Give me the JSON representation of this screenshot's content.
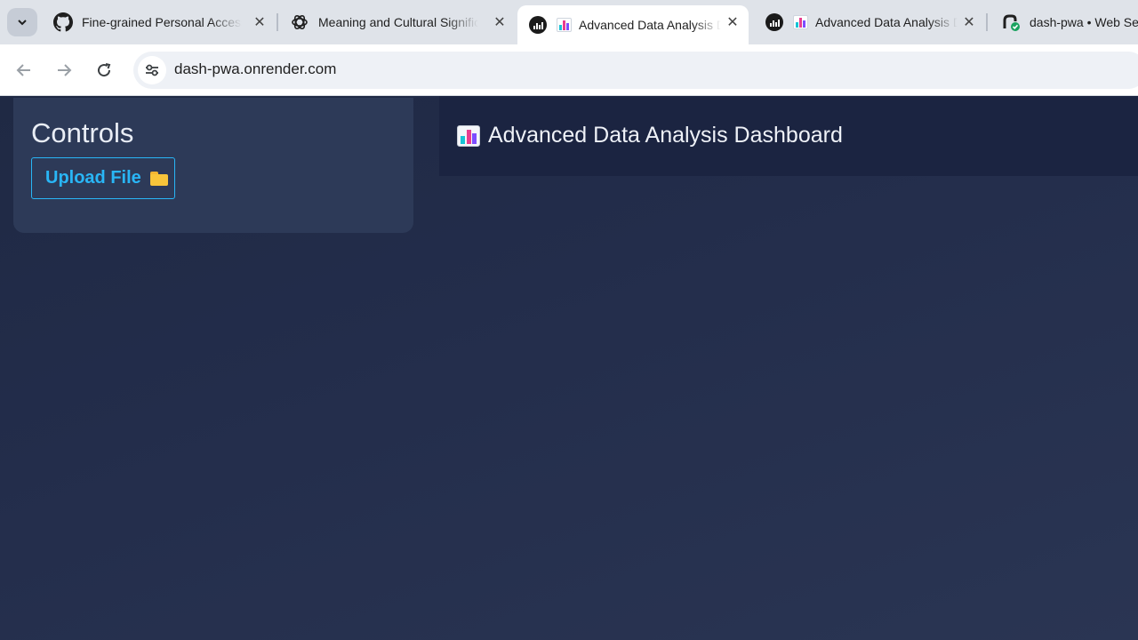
{
  "browser": {
    "tabs": [
      {
        "title": "Fine-grained Personal Access Tokens",
        "icon": "github-icon"
      },
      {
        "title": "Meaning and Cultural Significance",
        "icon": "openai-icon"
      },
      {
        "title": "Advanced Data Analysis Dashboard",
        "icon": "chart-favicon",
        "active": true
      },
      {
        "title": "Advanced Data Analysis Dashboard",
        "icon": "chart-favicon"
      },
      {
        "title": "dash-pwa • Web Service",
        "icon": "render-icon"
      }
    ],
    "url": "dash-pwa.onrender.com"
  },
  "sidebar": {
    "title": "Controls",
    "upload_label": "Upload File"
  },
  "header": {
    "title": "Advanced Data Analysis Dashboard"
  },
  "colors": {
    "accent": "#29b6f6",
    "page_bg": "#222c47",
    "card_bg": "#2d3a58",
    "header_bg": "#1b2441"
  }
}
